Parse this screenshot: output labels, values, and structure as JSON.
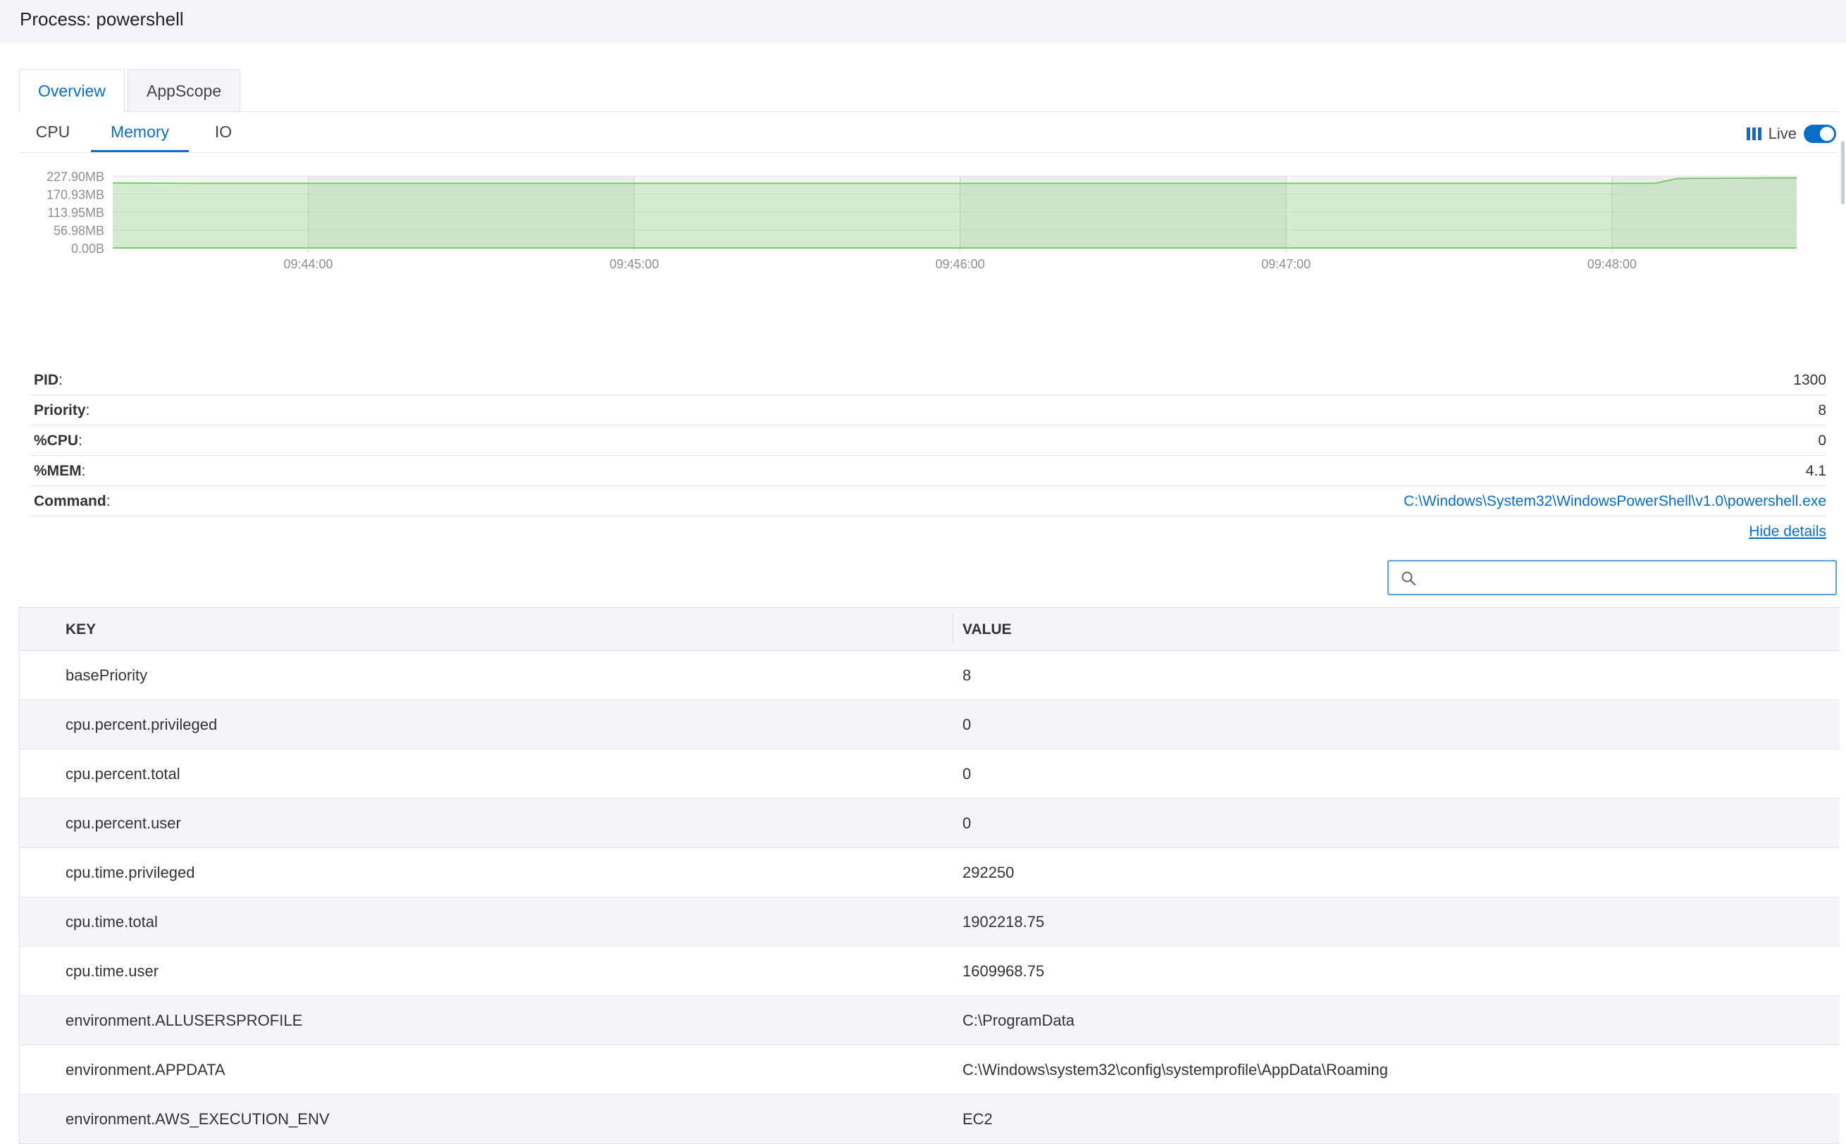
{
  "header": {
    "title": "Process: powershell"
  },
  "tabs": [
    {
      "label": "Overview",
      "active": true
    },
    {
      "label": "AppScope",
      "active": false
    }
  ],
  "subtabs": [
    {
      "label": "CPU",
      "active": false
    },
    {
      "label": "Memory",
      "active": true
    },
    {
      "label": "IO",
      "active": false
    }
  ],
  "live": {
    "label": "Live",
    "enabled": true,
    "icon": "bars-icon"
  },
  "chart_data": {
    "type": "area",
    "y_ticks": [
      "227.90MB",
      "170.93MB",
      "113.95MB",
      "56.98MB",
      "0.00B"
    ],
    "x_ticks": [
      "09:44:00",
      "09:45:00",
      "09:46:00",
      "09:47:00",
      "09:48:00"
    ],
    "ylim": [
      0,
      227.9
    ],
    "series": [
      {
        "color": "#7ccb6e",
        "points": [
          [
            "09:43:24",
            206.0
          ],
          [
            "09:43:40",
            205.0
          ],
          [
            "09:44:00",
            205.0
          ],
          [
            "09:45:00",
            205.0
          ],
          [
            "09:46:00",
            205.0
          ],
          [
            "09:47:00",
            205.0
          ],
          [
            "09:48:00",
            205.0
          ],
          [
            "09:48:08",
            205.0
          ],
          [
            "09:48:12",
            220.0
          ],
          [
            "09:48:20",
            221.0
          ],
          [
            "09:48:30",
            222.0
          ],
          [
            "09:48:34",
            222.0
          ]
        ]
      }
    ],
    "x_range": [
      "09:43:24",
      "09:48:34"
    ],
    "grid": true
  },
  "details": {
    "rows": [
      {
        "key": "PID",
        "value": "1300"
      },
      {
        "key": "Priority",
        "value": "8"
      },
      {
        "key": "%CPU",
        "value": "0"
      },
      {
        "key": "%MEM",
        "value": "4.1"
      },
      {
        "key": "Command",
        "value": "C:\\Windows\\System32\\WindowsPowerShell\\v1.0\\powershell.exe",
        "link": true
      }
    ],
    "hide_label": "Hide details"
  },
  "search": {
    "placeholder": "",
    "value": ""
  },
  "table": {
    "columns": [
      "KEY",
      "VALUE"
    ],
    "rows": [
      {
        "key": "basePriority",
        "value": "8"
      },
      {
        "key": "cpu.percent.privileged",
        "value": "0"
      },
      {
        "key": "cpu.percent.total",
        "value": "0"
      },
      {
        "key": "cpu.percent.user",
        "value": "0"
      },
      {
        "key": "cpu.time.privileged",
        "value": "292250"
      },
      {
        "key": "cpu.time.total",
        "value": "1902218.75"
      },
      {
        "key": "cpu.time.user",
        "value": "1609968.75"
      },
      {
        "key": "environment.ALLUSERSPROFILE",
        "value": "C:\\ProgramData"
      },
      {
        "key": "environment.APPDATA",
        "value": "C:\\Windows\\system32\\config\\systemprofile\\AppData\\Roaming"
      },
      {
        "key": "environment.AWS_EXECUTION_ENV",
        "value": "EC2"
      }
    ]
  },
  "colors": {
    "accent": "#0a6ec8",
    "area_fill": "#d9f2d3",
    "area_line": "#7ccb6e"
  }
}
